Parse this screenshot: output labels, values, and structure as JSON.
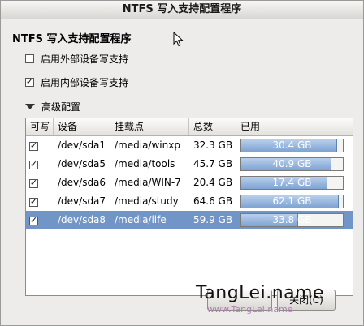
{
  "window": {
    "title": "NTFS 写入支持配置程序"
  },
  "heading": "NTFS 写入支持配置程序",
  "options": [
    {
      "label": "启用外部设备写支持",
      "checked": false
    },
    {
      "label": "启用内部设备写支持",
      "checked": true
    }
  ],
  "advanced": {
    "label": "高级配置"
  },
  "table": {
    "columns": [
      "可写",
      "设备",
      "挂载点",
      "总数",
      "已用"
    ],
    "rows": [
      {
        "writable": true,
        "device": "/dev/sda1",
        "mount": "/media/winxp",
        "total": "32.3 GB",
        "used": "30.4 GB",
        "fraction": 0.94,
        "selected": false
      },
      {
        "writable": true,
        "device": "/dev/sda5",
        "mount": "/media/tools",
        "total": "45.7 GB",
        "used": "40.9 GB",
        "fraction": 0.89,
        "selected": false
      },
      {
        "writable": true,
        "device": "/dev/sda6",
        "mount": "/media/WIN-7",
        "total": "20.4 GB",
        "used": "17.4 GB",
        "fraction": 0.85,
        "selected": false
      },
      {
        "writable": true,
        "device": "/dev/sda7",
        "mount": "/media/study",
        "total": "64.6 GB",
        "used": "62.1 GB",
        "fraction": 0.96,
        "selected": false
      },
      {
        "writable": true,
        "device": "/dev/sda8",
        "mount": "/media/life",
        "total": "59.9 GB",
        "used": "33.8 GB",
        "fraction": 0.56,
        "selected": true
      }
    ]
  },
  "watermark": {
    "text": "TangLei.name",
    "sub": "www.TangLei.name"
  },
  "buttons": {
    "close": "关闭(C)"
  }
}
